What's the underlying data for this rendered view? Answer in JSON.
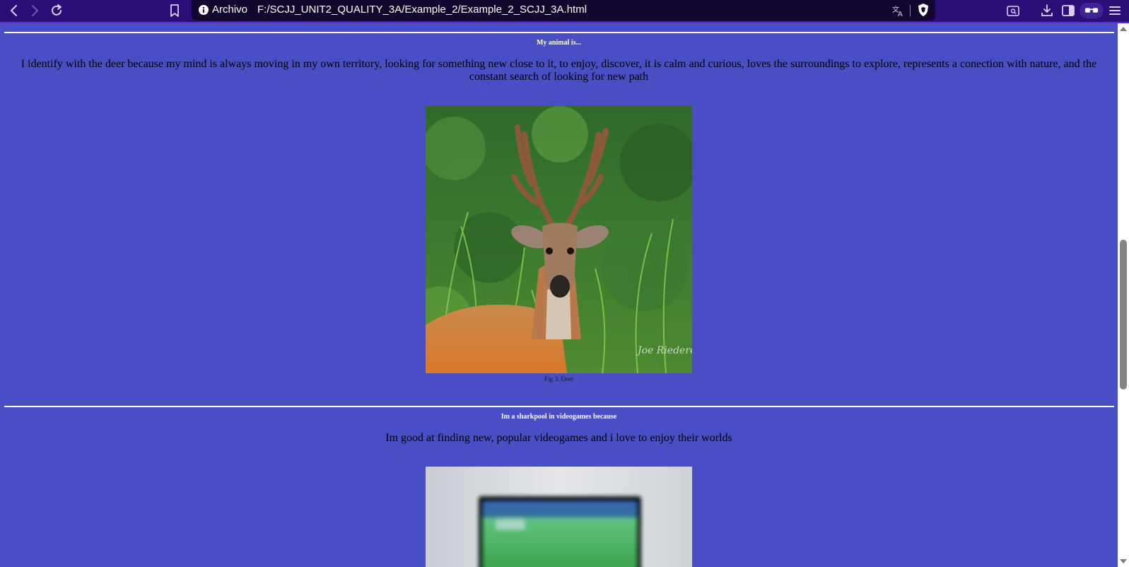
{
  "browser": {
    "url_scheme_label": "Archivo",
    "url": "F:/SCJJ_UNIT2_QUALITY_3A/Example_2/Example_2_SCJJ_3A.html"
  },
  "section1": {
    "heading": "My animal is...",
    "paragraph": "I identify with the deer because my mind is always moving in my own territory, looking for something new close to it, to enjoy, discover, it is calm and curious, loves the surroundings to explore, represents a conection with nature, and the constant search of looking for new path",
    "image": {
      "subject": "deer in tall grass",
      "watermark": "Joe Riederer"
    },
    "caption": "Fig 3: Deer"
  },
  "section2": {
    "heading": "Im a sharkpool in videogames because",
    "paragraph": "Im good at finding new, popular videogames and i love to enjoy their worlds",
    "image": {
      "subject": "blurred television showing a soccer videogame"
    }
  },
  "colors": {
    "page_background": "#4a4ec4",
    "toolbar_background": "#2a0f78",
    "urlbar_background": "#12082f"
  },
  "icons": {
    "toolbar": [
      "back-icon",
      "forward-icon",
      "reload-icon",
      "bookmark-icon",
      "info-icon",
      "translate-icon",
      "brave-shield-icon",
      "page-search-icon",
      "download-icon",
      "sidebar-icon",
      "wallet-icon",
      "menu-icon"
    ]
  }
}
